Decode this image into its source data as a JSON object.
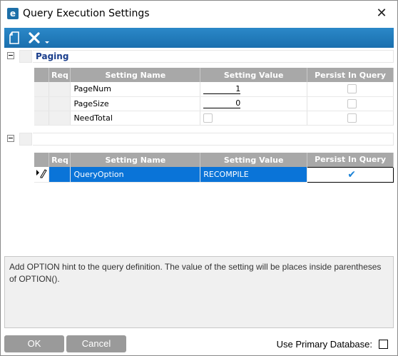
{
  "window": {
    "title": "Query Execution Settings",
    "app_icon_letter": "e",
    "close_glyph": "✕"
  },
  "toolbar": {
    "new_icon": "new-document-icon",
    "delete_icon": "delete-x-icon",
    "dropdown_icon": "chevron-down-icon",
    "accent": "#1a6fae"
  },
  "group1": {
    "label": "Paging",
    "headers": [
      "Req",
      "Setting Name",
      "Setting Value",
      "Persist In Query"
    ],
    "rows": [
      {
        "name": "PageNum",
        "value": "1",
        "value_type": "text",
        "persist": false
      },
      {
        "name": "PageSize",
        "value": "0",
        "value_type": "text",
        "persist": false
      },
      {
        "name": "NeedTotal",
        "value": "",
        "value_type": "checkbox",
        "persist": false
      }
    ]
  },
  "group2": {
    "label": "",
    "headers": [
      "Req",
      "Setting Name",
      "Setting Value",
      "Persist In Query"
    ],
    "rows": [
      {
        "name": "QueryOption",
        "value": "RECOMPILE",
        "persist": true,
        "selected": true
      }
    ]
  },
  "description": "Add OPTION hint to the query definition. The value of the setting will be places inside parentheses of OPTION().",
  "buttons": {
    "ok": "OK",
    "cancel": "Cancel"
  },
  "primary_db": {
    "label": "Use Primary Database:",
    "checked": false
  },
  "colors": {
    "header_bg": "#a8a8a8",
    "selection": "#0a74d8",
    "button_bg": "#9a9a9a"
  }
}
